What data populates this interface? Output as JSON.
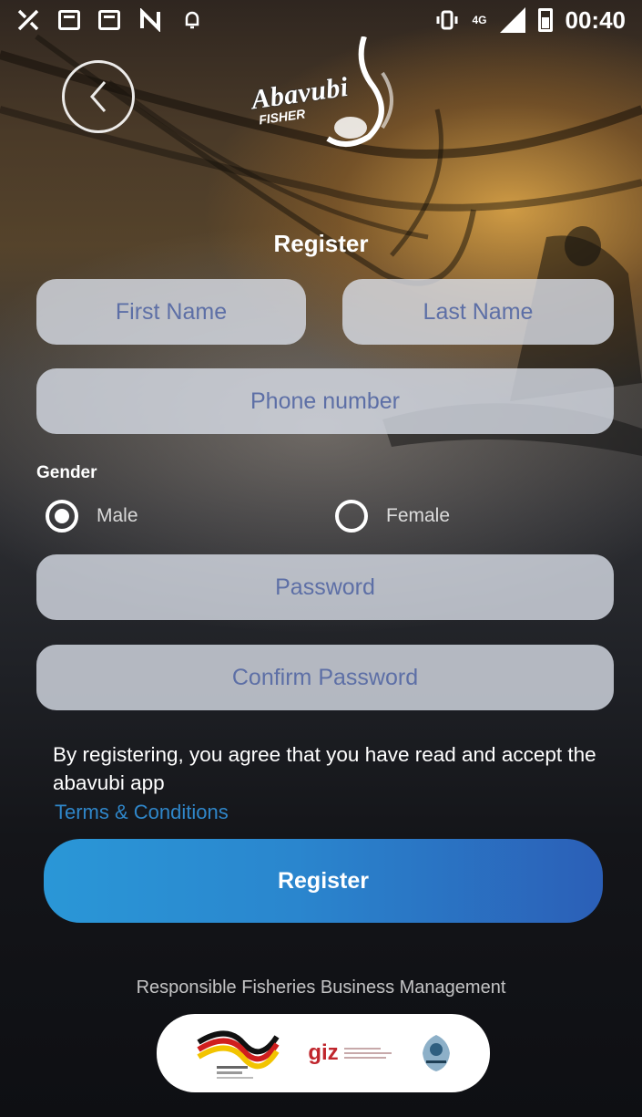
{
  "status_bar": {
    "network": "4G",
    "time": "00:40"
  },
  "header": {
    "logo_text": "Abavubi",
    "logo_subtext": "FISHER"
  },
  "form": {
    "title": "Register",
    "first_name_placeholder": "First Name",
    "last_name_placeholder": "Last Name",
    "phone_placeholder": "Phone number",
    "gender_label": "Gender",
    "gender_options": [
      {
        "label": "Male",
        "selected": true
      },
      {
        "label": "Female",
        "selected": false
      }
    ],
    "password_placeholder": "Password",
    "confirm_password_placeholder": "Confirm Password",
    "terms_text": "By registering, you agree that you have read and accept the abavubi app",
    "terms_link": "Terms & Conditions",
    "submit_label": "Register"
  },
  "footer": {
    "tagline": "Responsible Fisheries Business Management",
    "partner_giz": "giz"
  },
  "colors": {
    "accent_button_start": "#2a97d7",
    "accent_button_end": "#2b5fb7",
    "link": "#2f86c9",
    "placeholder_text": "#5d6fa6"
  }
}
